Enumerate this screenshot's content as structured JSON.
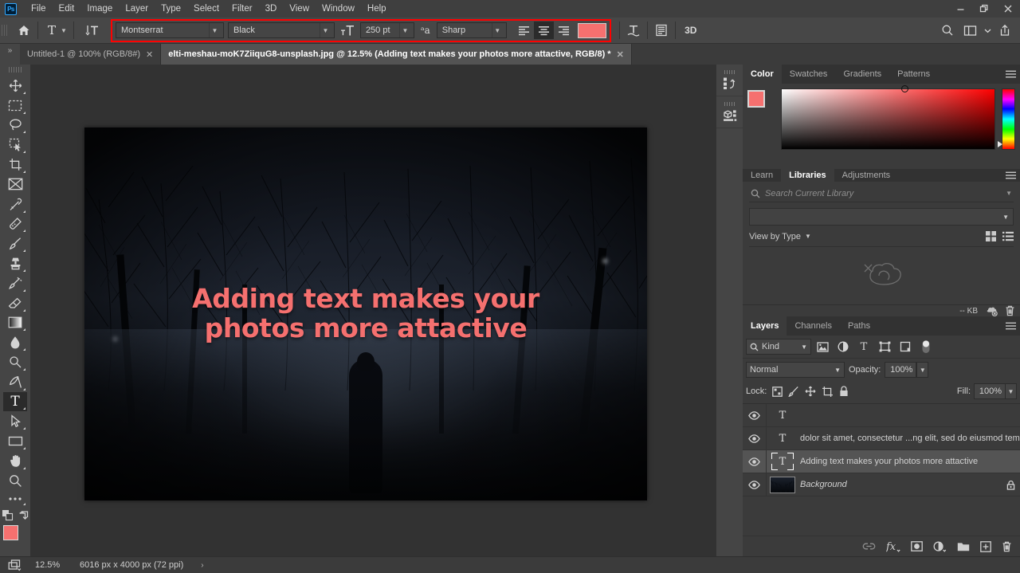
{
  "app": {
    "logo": "Ps"
  },
  "menubar": {
    "items": [
      "File",
      "Edit",
      "Image",
      "Layer",
      "Type",
      "Select",
      "Filter",
      "3D",
      "View",
      "Window",
      "Help"
    ],
    "window_controls": [
      {
        "name": "minimize",
        "glyph": "–"
      },
      {
        "name": "restore",
        "glyph": "❐"
      },
      {
        "name": "close",
        "glyph": "✕"
      }
    ]
  },
  "options_bar": {
    "home_icon": "home-icon",
    "tool_icon": "type-tool-icon",
    "orientation_icon": "text-orientation-icon",
    "font_family": "Montserrat",
    "font_style": "Black",
    "font_size": "250 pt",
    "anti_alias": "Sharp",
    "align": {
      "left": "align-left",
      "center": "align-center",
      "right": "align-right",
      "selected": "center"
    },
    "text_color": "#f5706f",
    "warp_icon": "warp-text-icon",
    "panels_icon": "character-paragraph-panels-icon",
    "three_d_label": "3D",
    "search_icon": "search-icon",
    "workspace_icon": "workspace-icon",
    "share_icon": "share-icon",
    "highlight_color": "#ff0000"
  },
  "tabs": {
    "collapse_glyph": "»",
    "items": [
      {
        "label": "Untitled-1 @ 100% (RGB/8#)",
        "active": false
      },
      {
        "label": "elti-meshau-moK7ZiiquG8-unsplash.jpg @ 12.5% (Adding text makes your photos more attactive, RGB/8) *",
        "active": true
      }
    ]
  },
  "toolbar": {
    "tools": [
      {
        "name": "move-tool",
        "icon": "move-icon"
      },
      {
        "name": "rectangular-marquee-tool",
        "icon": "marquee-icon"
      },
      {
        "name": "lasso-tool",
        "icon": "lasso-icon"
      },
      {
        "name": "object-selection-tool",
        "icon": "object-selection-icon"
      },
      {
        "name": "crop-tool",
        "icon": "crop-icon"
      },
      {
        "name": "frame-tool",
        "icon": "frame-icon"
      },
      {
        "name": "eyedropper-tool",
        "icon": "eyedropper-icon"
      },
      {
        "name": "spot-healing-brush-tool",
        "icon": "healing-brush-icon"
      },
      {
        "name": "brush-tool",
        "icon": "brush-icon"
      },
      {
        "name": "clone-stamp-tool",
        "icon": "stamp-icon"
      },
      {
        "name": "history-brush-tool",
        "icon": "history-brush-icon"
      },
      {
        "name": "eraser-tool",
        "icon": "eraser-icon"
      },
      {
        "name": "gradient-tool",
        "icon": "gradient-icon"
      },
      {
        "name": "blur-tool",
        "icon": "blur-drop-icon"
      },
      {
        "name": "dodge-tool",
        "icon": "dodge-icon"
      },
      {
        "name": "pen-tool",
        "icon": "pen-icon"
      },
      {
        "name": "horizontal-type-tool",
        "icon": "type-icon",
        "active": true
      },
      {
        "name": "path-selection-tool",
        "icon": "path-arrow-icon"
      },
      {
        "name": "rectangle-tool",
        "icon": "rectangle-icon"
      },
      {
        "name": "hand-tool",
        "icon": "hand-icon"
      },
      {
        "name": "zoom-tool",
        "icon": "zoom-icon"
      },
      {
        "name": "edit-toolbar",
        "icon": "ellipsis-icon"
      }
    ],
    "foreground_color": "#f5706f",
    "background_color": "#ffffff",
    "quick-mask": "quick-mask-icon"
  },
  "canvas": {
    "text_line_1": "Adding text makes your",
    "text_line_2": "photos more attactive",
    "text_color": "#f5706f"
  },
  "dock_rail": {
    "items": [
      {
        "name": "history-panel",
        "icon": "history-icon"
      },
      {
        "name": "properties-panel",
        "icon": "properties-icon"
      }
    ]
  },
  "color_panel": {
    "tabs": [
      "Color",
      "Swatches",
      "Gradients",
      "Patterns"
    ],
    "active_tab": "Color",
    "foreground": "#f5706f",
    "background": "#ffffff",
    "menu_icon": "panel-menu-icon"
  },
  "libraries_panel": {
    "tabs": [
      "Learn",
      "Libraries",
      "Adjustments"
    ],
    "active_tab": "Libraries",
    "search_placeholder": "Search Current Library",
    "search_value": "",
    "library_select_value": "",
    "view_by": "View by Type",
    "grid_view_icon": "grid-view-icon",
    "list_view_icon": "list-view-icon",
    "empty_icon": "creative-cloud-offline-icon",
    "size_label": "-- KB",
    "sync_icon": "cloud-offline-icon",
    "delete_icon": "trash-icon",
    "menu_icon": "panel-menu-icon"
  },
  "layers_panel": {
    "tabs": [
      "Layers",
      "Channels",
      "Paths"
    ],
    "active_tab": "Layers",
    "menu_icon": "panel-menu-icon",
    "filter_kind": "Kind",
    "filter_icons": [
      "pixel-filter-icon",
      "adjustment-filter-icon",
      "type-filter-icon",
      "shape-filter-icon",
      "smart-object-filter-icon"
    ],
    "filter_toggle": "filter-toggle-icon",
    "blend_mode": "Normal",
    "opacity_label": "Opacity:",
    "opacity_value": "100%",
    "lock_label": "Lock:",
    "lock_icons": [
      "lock-transparent-pixels-icon",
      "lock-image-pixels-icon",
      "lock-position-icon",
      "lock-artboard-nesting-icon",
      "lock-all-icon"
    ],
    "fill_label": "Fill:",
    "fill_value": "100%",
    "layers": [
      {
        "name": "",
        "type": "text",
        "visible": true,
        "selected": false,
        "locked": false
      },
      {
        "name": "dolor sit amet, consectetur ...ng elit, sed do eiusmod tem",
        "type": "text",
        "visible": true,
        "selected": false,
        "locked": false
      },
      {
        "name": "Adding text makes your photos more attactive",
        "type": "text",
        "visible": true,
        "selected": true,
        "locked": false
      },
      {
        "name": "Background",
        "type": "image",
        "visible": true,
        "selected": false,
        "locked": true
      }
    ],
    "footer_icons": [
      "link-layers-icon",
      "add-layer-style-icon",
      "add-layer-mask-icon",
      "new-fill-adjustment-layer-icon",
      "new-group-icon",
      "new-layer-icon",
      "delete-layer-icon"
    ]
  },
  "status_bar": {
    "doc_icon": "document-arrange-icon",
    "zoom": "12.5%",
    "doc_info": "6016 px x 4000 px (72 ppi)",
    "expand_glyph": "›"
  }
}
